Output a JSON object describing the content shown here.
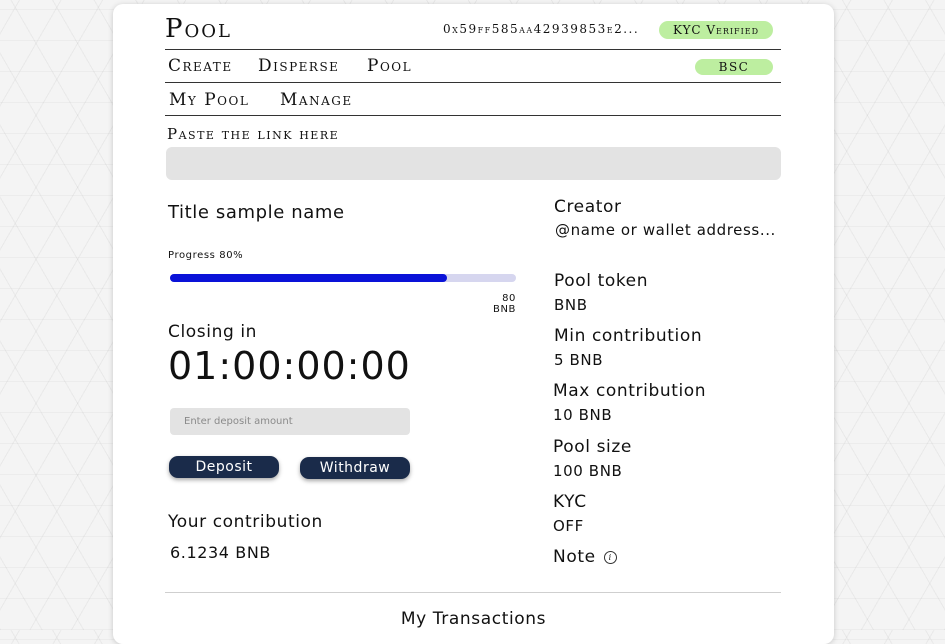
{
  "header": {
    "logo": "Pool",
    "wallet_address": "0x59ff585aa42939853e2...",
    "kyc_badge": "KYC Verified",
    "network_badge": "BSC"
  },
  "nav": {
    "items": [
      "Create",
      "Disperse",
      "Pool"
    ],
    "sub_items": [
      "My Pool",
      "Manage"
    ]
  },
  "link": {
    "label": "Paste the link here",
    "value": "",
    "placeholder": ""
  },
  "pool": {
    "title": "Title sample name",
    "progress_label": "Progress 80%",
    "progress_fraction": 0.8,
    "progress_amount": "80 BNB",
    "closing_label": "Closing in",
    "countdown": "01:00:00:00",
    "deposit_placeholder": "Enter deposit amount",
    "deposit_button": "Deposit",
    "withdraw_button": "Withdraw",
    "contribution_label": "Your contribution",
    "contribution_value": "6.1234 BNB"
  },
  "details": {
    "creator_label": "Creator",
    "creator_value": "@name or wallet address...",
    "token_label": "Pool token",
    "token_value": "BNB",
    "min_label": "Min contribution",
    "min_value": "5 BNB",
    "max_label": "Max contribution",
    "max_value": "10 BNB",
    "size_label": "Pool size",
    "size_value": "100 BNB",
    "kyc_label": "KYC",
    "kyc_value": "OFF",
    "note_label": "Note",
    "note_icon": "info-icon"
  },
  "transactions": {
    "title": "My Transactions"
  },
  "colors": {
    "progress_fill": "#0a12d8",
    "progress_track": "#d6d6ef",
    "badge": "#bdeea0",
    "button": "#1a2b4a"
  }
}
